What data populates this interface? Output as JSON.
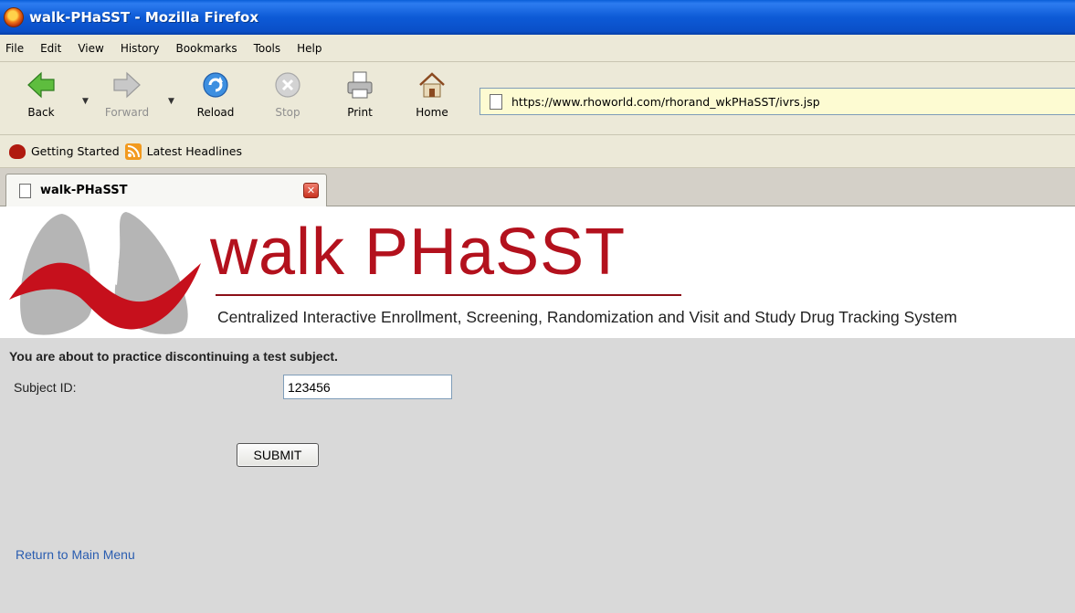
{
  "window": {
    "title": "walk-PHaSST - Mozilla Firefox"
  },
  "menu": [
    "File",
    "Edit",
    "View",
    "History",
    "Bookmarks",
    "Tools",
    "Help"
  ],
  "toolbar": {
    "back": "Back",
    "forward": "Forward",
    "reload": "Reload",
    "stop": "Stop",
    "print": "Print",
    "home": "Home"
  },
  "address": {
    "url": "https://www.rhoworld.com/rhorand_wkPHaSST/ivrs.jsp"
  },
  "bookmarks": [
    "Getting Started",
    "Latest Headlines"
  ],
  "tab": {
    "label": "walk-PHaSST"
  },
  "page": {
    "brand": "walk PHaSST",
    "subtitle": "Centralized Interactive Enrollment, Screening, Randomization and Visit and Study Drug Tracking System",
    "notice": "You are about to practice discontinuing a test subject.",
    "subject_label": "Subject ID:",
    "subject_value": "123456",
    "submit_label": "SUBMIT",
    "return_link": "Return to Main Menu"
  },
  "colors": {
    "brand_red": "#b3111d",
    "titlebar_blue": "#0a5fd8",
    "link_blue": "#2a5db0"
  },
  "icons": [
    "firefox-icon",
    "back-icon",
    "forward-icon",
    "reload-icon",
    "stop-icon",
    "print-icon",
    "home-icon",
    "page-icon",
    "getting-started-icon",
    "rss-icon",
    "close-icon",
    "lungs-logo"
  ]
}
